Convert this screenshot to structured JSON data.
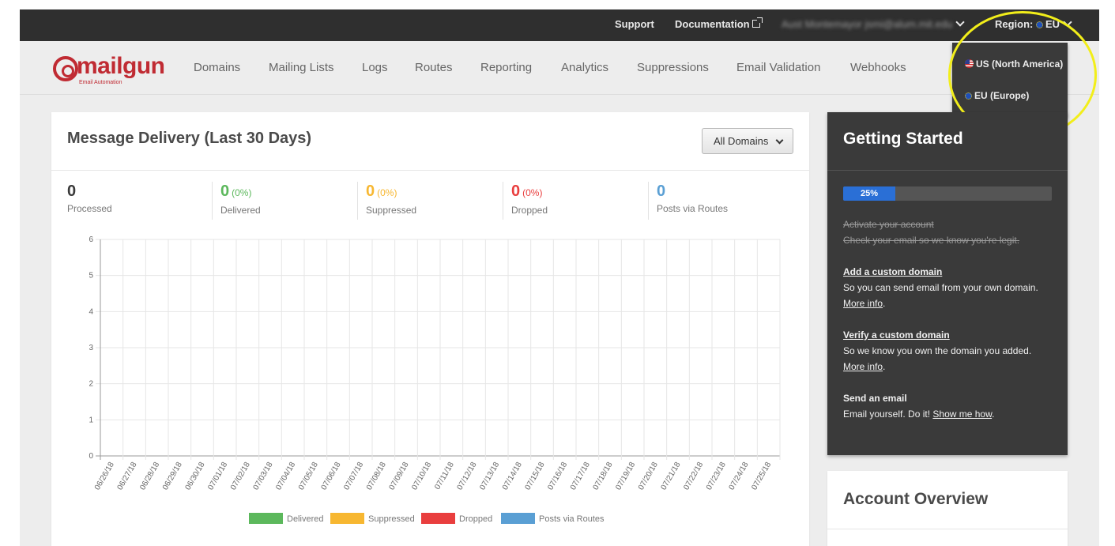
{
  "topbar": {
    "support": "Support",
    "documentation": "Documentation",
    "account_email": "Aust Montemayor jsmi@alum.mit.edu",
    "region_label": "Region:",
    "region_value": "EU"
  },
  "region_menu": {
    "options": [
      {
        "label": "US (North America)",
        "icon": "us-flag-icon"
      },
      {
        "label": "EU (Europe)",
        "icon": "eu-flag-icon"
      }
    ]
  },
  "logo": {
    "name": "mailgun",
    "tagline": "Email Automation"
  },
  "nav": {
    "items": [
      "Domains",
      "Mailing Lists",
      "Logs",
      "Routes",
      "Reporting",
      "Analytics",
      "Suppressions",
      "Email Validation",
      "Webhooks"
    ]
  },
  "delivery": {
    "title": "Message Delivery (Last 30 Days)",
    "filter": "All Domains",
    "stats": [
      {
        "value": "0",
        "pct": "",
        "label": "Processed",
        "color": "#3a3a3a"
      },
      {
        "value": "0",
        "pct": "(0%)",
        "label": "Delivered",
        "color": "#5cb85c"
      },
      {
        "value": "0",
        "pct": "(0%)",
        "label": "Suppressed",
        "color": "#f7b731"
      },
      {
        "value": "0",
        "pct": "(0%)",
        "label": "Dropped",
        "color": "#e93e3e"
      },
      {
        "value": "0",
        "pct": "",
        "label": "Posts via Routes",
        "color": "#5a9fd4"
      }
    ]
  },
  "chart_data": {
    "type": "bar",
    "categories": [
      "06/26/18",
      "06/27/18",
      "06/28/18",
      "06/29/18",
      "06/30/18",
      "07/01/18",
      "07/02/18",
      "07/03/18",
      "07/04/18",
      "07/05/18",
      "07/06/18",
      "07/07/18",
      "07/08/18",
      "07/09/18",
      "07/10/18",
      "07/11/18",
      "07/12/18",
      "07/13/18",
      "07/14/18",
      "07/15/18",
      "07/16/18",
      "07/17/18",
      "07/18/18",
      "07/19/18",
      "07/20/18",
      "07/21/18",
      "07/22/18",
      "07/23/18",
      "07/24/18",
      "07/25/18"
    ],
    "series": [
      {
        "name": "Delivered",
        "color": "#5cb85c",
        "values": [
          0,
          0,
          0,
          0,
          0,
          0,
          0,
          0,
          0,
          0,
          0,
          0,
          0,
          0,
          0,
          0,
          0,
          0,
          0,
          0,
          0,
          0,
          0,
          0,
          0,
          0,
          0,
          0,
          0,
          0
        ]
      },
      {
        "name": "Suppressed",
        "color": "#f7b731",
        "values": [
          0,
          0,
          0,
          0,
          0,
          0,
          0,
          0,
          0,
          0,
          0,
          0,
          0,
          0,
          0,
          0,
          0,
          0,
          0,
          0,
          0,
          0,
          0,
          0,
          0,
          0,
          0,
          0,
          0,
          0
        ]
      },
      {
        "name": "Dropped",
        "color": "#e93e3e",
        "values": [
          0,
          0,
          0,
          0,
          0,
          0,
          0,
          0,
          0,
          0,
          0,
          0,
          0,
          0,
          0,
          0,
          0,
          0,
          0,
          0,
          0,
          0,
          0,
          0,
          0,
          0,
          0,
          0,
          0,
          0
        ]
      },
      {
        "name": "Posts via Routes",
        "color": "#5a9fd4",
        "values": [
          0,
          0,
          0,
          0,
          0,
          0,
          0,
          0,
          0,
          0,
          0,
          0,
          0,
          0,
          0,
          0,
          0,
          0,
          0,
          0,
          0,
          0,
          0,
          0,
          0,
          0,
          0,
          0,
          0,
          0
        ]
      }
    ],
    "yticks": [
      0,
      1,
      2,
      3,
      4,
      5,
      6
    ],
    "ylim": [
      0,
      6
    ],
    "grid": true,
    "legend": "bottom"
  },
  "getting_started": {
    "title": "Getting Started",
    "progress_label": "25%",
    "progress": 0.25,
    "items": [
      {
        "heading": "Activate your account",
        "text": "Check your email so we know you're legit.",
        "link": ""
      },
      {
        "heading": "Add a custom domain",
        "text": "So you can send email from your own domain.",
        "link": "More info"
      },
      {
        "heading": "Verify a custom domain",
        "text": "So we know you own the domain you added.",
        "link": "More info"
      },
      {
        "heading": "Send an email",
        "text": "Email yourself. Do it!",
        "link": "Show me how"
      }
    ]
  },
  "account_overview": {
    "title": "Account Overview"
  }
}
